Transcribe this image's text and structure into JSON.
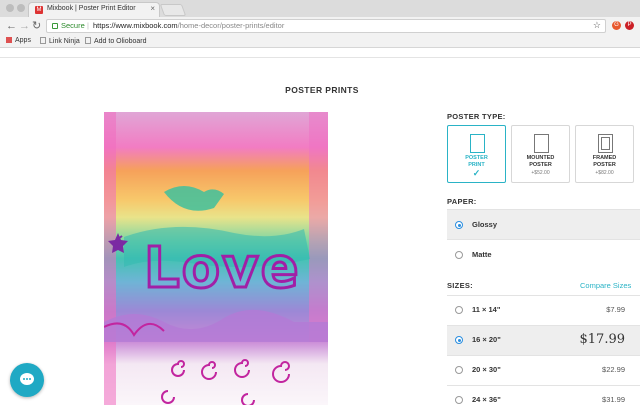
{
  "browser": {
    "tab_title": "Mixbook | Poster Print Editor",
    "tab_close": "×",
    "favicon_text": "M",
    "secure_label": "Secure",
    "url_host": "https://www.mixbook.com",
    "url_path": "/home-decor/poster-prints/editor",
    "bookmarks": [
      "Apps",
      "Link Ninja",
      "Add to Olioboard"
    ],
    "back_glyph": "←",
    "forward_glyph": "→",
    "reload_glyph": "↻",
    "star_glyph": "☆",
    "ext1_text": "G",
    "ext2_text": "P"
  },
  "page": {
    "title": "POSTER PRINTS"
  },
  "poster_type": {
    "label": "POSTER TYPE:",
    "options": [
      {
        "line1": "POSTER",
        "line2": "PRINT",
        "price": "",
        "selected": true
      },
      {
        "line1": "MOUNTED",
        "line2": "POSTER",
        "price": "+$52.00",
        "selected": false
      },
      {
        "line1": "FRAMED",
        "line2": "POSTER",
        "price": "+$82.00",
        "selected": false
      }
    ],
    "check": "✓"
  },
  "paper": {
    "label": "PAPER:",
    "options": [
      {
        "label": "Glossy",
        "selected": true
      },
      {
        "label": "Matte",
        "selected": false
      }
    ]
  },
  "sizes": {
    "label": "SIZES:",
    "compare_link": "Compare Sizes",
    "options": [
      {
        "label": "11 × 14\"",
        "price": "$7.99",
        "selected": false
      },
      {
        "label": "16 × 20\"",
        "price": "$17.99",
        "selected": true
      },
      {
        "label": "20 × 30\"",
        "price": "$22.99",
        "selected": false
      },
      {
        "label": "24 × 36\"",
        "price": "$31.99",
        "selected": false
      }
    ]
  },
  "artwork": {
    "text": "Love"
  },
  "icons": {
    "chat": "chat-icon",
    "lock": "lock-icon",
    "star": "bookmark-star-icon"
  },
  "colors": {
    "accent": "#2ab3c6",
    "radio_selected": "#2a8ee0",
    "chat_button": "#1fa9c4"
  }
}
